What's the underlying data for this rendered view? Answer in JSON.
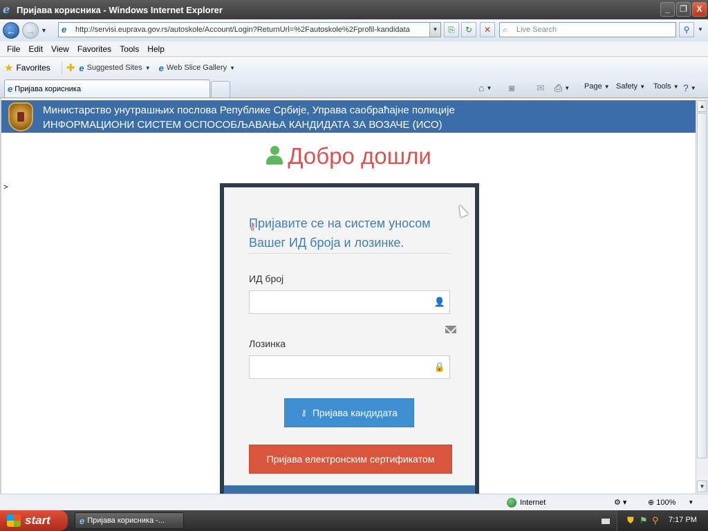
{
  "window": {
    "title": "Пријава корисника - Windows Internet Explorer",
    "buttons": {
      "minimize": "_",
      "restore": "❐",
      "close": "X"
    }
  },
  "address": {
    "url": "http://servisi.euprava.gov.rs/autoskole/Account/Login?ReturnUrl=%2Fautoskole%2Fprofil-kandidata",
    "search_placeholder": "Live Search"
  },
  "menu": [
    "File",
    "Edit",
    "View",
    "Favorites",
    "Tools",
    "Help"
  ],
  "favorites": {
    "label": "Favorites",
    "items": [
      {
        "label": "Suggested Sites"
      },
      {
        "label": "Web Slice Gallery"
      }
    ]
  },
  "tabs": [
    {
      "label": "Пријава корисника"
    }
  ],
  "commands": {
    "page": "Page",
    "safety": "Safety",
    "tools": "Tools"
  },
  "site": {
    "header_line1": "Министарство унутрашњих послова Републике Србије, Управа саобраћајне полиције",
    "header_line2": "ИНФОРМАЦИОНИ СИСТЕМ ОСПОСОБЉАВАЊА КАНДИДАТА ЗА ВОЗАЧЕ (ИСО)",
    "welcome": "Добро дошли",
    "stray_char": ">"
  },
  "login": {
    "prompt": "Пријавите се на систем уносом Вашег ИД броја и лозинке.",
    "id_label": "ИД број",
    "id_value": "",
    "password_label": "Лозинка",
    "password_value": "",
    "candidate_button": "Пријава кандидата",
    "certificate_button": "Пријава електронским сертификатом"
  },
  "status": {
    "zone": "Internet",
    "zoom": "100%"
  },
  "taskbar": {
    "start": "start",
    "item": "Пријава корисника -...",
    "clock": "7:17 PM"
  },
  "colors": {
    "header_blue": "#3b6ea8",
    "welcome_red": "#d9534f",
    "prompt_blue": "#3e7fb8",
    "button_blue": "#3d8fd1",
    "button_red": "#d9563c",
    "panel_border": "#2f3a4a"
  }
}
